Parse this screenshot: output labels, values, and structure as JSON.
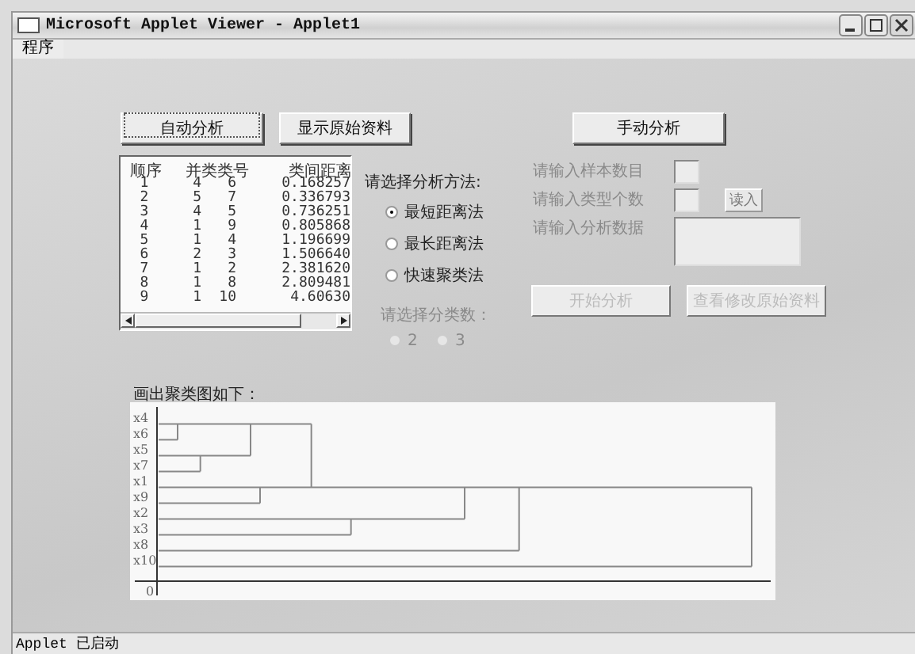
{
  "window": {
    "title": "Microsoft Applet Viewer - Applet1"
  },
  "menu": [
    "程序"
  ],
  "buttons": {
    "auto": "自动分析",
    "show_raw": "显示原始资料",
    "manual": "手动分析"
  },
  "results": {
    "columns": [
      "顺序",
      "并类类号",
      "类间距离"
    ],
    "rows": [
      {
        "order": "1",
        "a": "4",
        "b": "6",
        "distance": "0.168257"
      },
      {
        "order": "2",
        "a": "5",
        "b": "7",
        "distance": "0.336793"
      },
      {
        "order": "3",
        "a": "4",
        "b": "5",
        "distance": "0.736251"
      },
      {
        "order": "4",
        "a": "1",
        "b": "9",
        "distance": "0.805868"
      },
      {
        "order": "5",
        "a": "1",
        "b": "4",
        "distance": "1.196699"
      },
      {
        "order": "6",
        "a": "2",
        "b": "3",
        "distance": "1.506640"
      },
      {
        "order": "7",
        "a": "1",
        "b": "2",
        "distance": "2.381620"
      },
      {
        "order": "8",
        "a": "1",
        "b": "8",
        "distance": "2.809481"
      },
      {
        "order": "9",
        "a": "1",
        "b": "10",
        "distance": "4.60630"
      }
    ]
  },
  "method": {
    "label": "请选择分析方法:",
    "options": [
      {
        "label": "最短距离法",
        "selected": true
      },
      {
        "label": "最长距离法",
        "selected": false
      },
      {
        "label": "快速聚类法",
        "selected": false
      }
    ]
  },
  "class_count": {
    "label": "请选择分类数：",
    "disabled": true,
    "options": [
      {
        "label": "2",
        "selected": false
      },
      {
        "label": "3",
        "selected": false
      }
    ]
  },
  "manual_form": {
    "fields": [
      {
        "label": "请输入样本数目",
        "disabled": true,
        "kind": "input"
      },
      {
        "label": "请输入类型个数",
        "disabled": true,
        "kind": "input",
        "button": "读入"
      },
      {
        "label": "请输入分析数据",
        "disabled": true,
        "kind": "textarea"
      }
    ],
    "buttons": [
      {
        "label": "开始分析",
        "disabled": true
      },
      {
        "label": "查看修改原始资料",
        "disabled": true
      }
    ]
  },
  "dendrogram": {
    "title": "画出聚类图如下：",
    "leaves": [
      "x4",
      "x6",
      "x5",
      "x7",
      "x1",
      "x9",
      "x2",
      "x3",
      "x8",
      "x10"
    ],
    "axis_label": "0"
  },
  "status_bar": "Applet 已启动"
}
